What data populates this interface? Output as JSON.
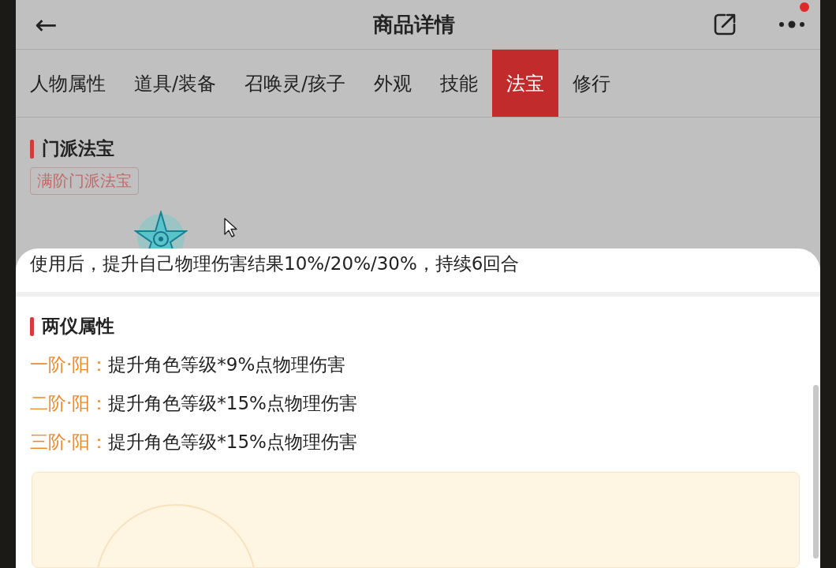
{
  "header": {
    "title": "商品详情",
    "back_icon": "←"
  },
  "tabs": [
    {
      "label": "人物属性",
      "selected": false
    },
    {
      "label": "道具/装备",
      "selected": false
    },
    {
      "label": "召唤灵/孩子",
      "selected": false
    },
    {
      "label": "外观",
      "selected": false
    },
    {
      "label": "技能",
      "selected": false
    },
    {
      "label": "法宝",
      "selected": true
    },
    {
      "label": "修行",
      "selected": false
    }
  ],
  "school_treasure": {
    "heading": "门派法宝",
    "tag": "满阶门派法宝",
    "description": "使用后，提升自己物理伤害结果10%/20%/30%，持续6回合"
  },
  "liangyi": {
    "heading": "两仪属性",
    "rows": [
      {
        "label": "一阶·阳：",
        "text": "提升角色等级*9%点物理伤害"
      },
      {
        "label": "二阶·阳：",
        "text": "提升角色等级*15%点物理伤害"
      },
      {
        "label": "三阶·阳：",
        "text": "提升角色等级*15%点物理伤害"
      }
    ]
  }
}
